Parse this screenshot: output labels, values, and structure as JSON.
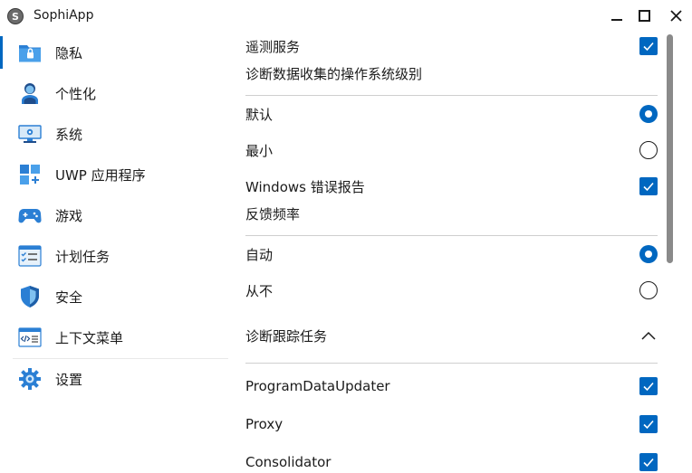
{
  "window": {
    "app_icon_glyph": "S",
    "title": "SophiApp"
  },
  "sidebar": {
    "items": [
      {
        "label": "隐私",
        "icon": "privacy-folder-icon"
      },
      {
        "label": "个性化",
        "icon": "personalization-person-icon"
      },
      {
        "label": "系统",
        "icon": "system-monitor-icon"
      },
      {
        "label": "UWP 应用程序",
        "icon": "uwp-apps-grid-icon"
      },
      {
        "label": "游戏",
        "icon": "gamepad-icon"
      },
      {
        "label": "计划任务",
        "icon": "scheduled-tasks-icon"
      },
      {
        "label": "安全",
        "icon": "shield-icon"
      },
      {
        "label": "上下文菜单",
        "icon": "context-menu-icon"
      },
      {
        "label": "设置",
        "icon": "gear-icon"
      }
    ],
    "active_index": 0
  },
  "content": {
    "telemetry": {
      "label": "遥测服务",
      "checked": true
    },
    "diag_level_header": "诊断数据收集的操作系统级别",
    "diag_levels": [
      {
        "label": "默认",
        "selected": true
      },
      {
        "label": "最小",
        "selected": false
      }
    ],
    "error_reporting": {
      "label": "Windows 错误报告",
      "checked": true
    },
    "feedback_header": "反馈频率",
    "feedback_options": [
      {
        "label": "自动",
        "selected": true
      },
      {
        "label": "从不",
        "selected": false
      }
    ],
    "diag_tasks": {
      "label": "诊断跟踪任务",
      "expanded": true,
      "items": [
        {
          "label": "ProgramDataUpdater",
          "checked": true
        },
        {
          "label": "Proxy",
          "checked": true
        },
        {
          "label": "Consolidator",
          "checked": true
        }
      ]
    }
  },
  "colors": {
    "accent": "#0067c0",
    "text": "#1b1b1b",
    "divider": "#cfcfcf",
    "scroll_thumb": "#8a8a8a"
  }
}
